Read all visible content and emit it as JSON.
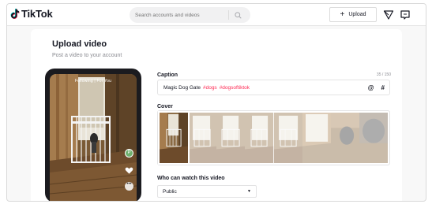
{
  "header": {
    "logo_text": "TikTok",
    "search_placeholder": "Search accounts and videos",
    "upload_label": "Upload",
    "icons": [
      "tiktok-logo-icon",
      "search-icon",
      "plus-icon",
      "send-icon",
      "inbox-icon"
    ]
  },
  "page": {
    "title": "Upload video",
    "subtitle": "Post a video to your account"
  },
  "preview": {
    "feed_tabs": "Following | For You"
  },
  "caption": {
    "label": "Caption",
    "counter": "35 / 150",
    "text": "Magic Dog Gate",
    "hashtags": [
      "#dogs",
      "#dogsoftiktok"
    ],
    "mention_symbol": "@",
    "hashtag_symbol": "#"
  },
  "cover": {
    "label": "Cover",
    "frames": 8,
    "selected_frame": 1
  },
  "privacy": {
    "label": "Who can watch this video",
    "selected": "Public"
  },
  "colors": {
    "accent": "#fe2c55",
    "text": "#161823",
    "muted": "#8a8b91",
    "background": "#f8f8f8"
  }
}
